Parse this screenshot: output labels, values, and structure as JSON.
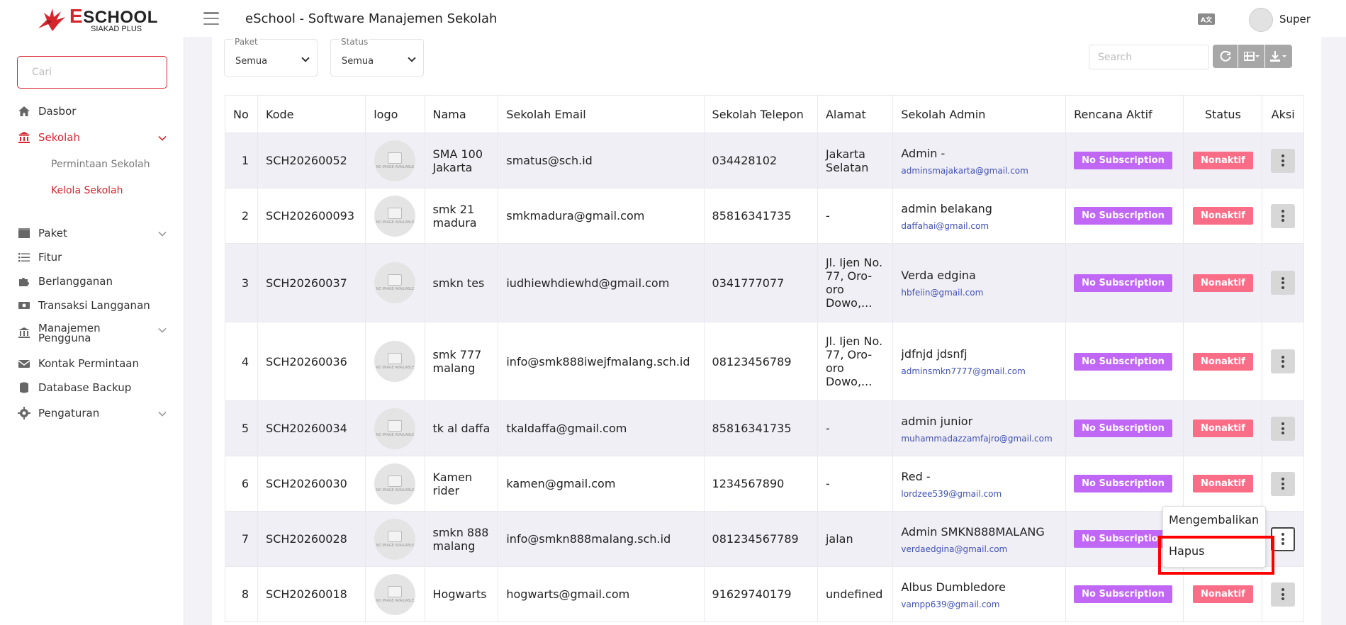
{
  "header": {
    "logo_title_first": "E",
    "logo_title_rest": "SCHOOL",
    "logo_subtitle": "SIAKAD PLUS",
    "app_title": "eSchool - Software Manajemen Sekolah",
    "lang_icon_label": "A文",
    "user_name": "Super"
  },
  "sidebar": {
    "search_placeholder": "Cari",
    "items": [
      {
        "label": "Dasbor",
        "icon": "home-icon"
      },
      {
        "label": "Sekolah",
        "icon": "school-icon"
      },
      {
        "label": "Permintaan Sekolah"
      },
      {
        "label": "Kelola Sekolah"
      },
      {
        "label": "Paket",
        "icon": "package-icon"
      },
      {
        "label": "Fitur",
        "icon": "list-icon"
      },
      {
        "label": "Berlangganan",
        "icon": "puzzle-icon"
      },
      {
        "label": "Transaksi Langganan",
        "icon": "money-icon"
      },
      {
        "label": "Manajemen Pengguna",
        "icon": "user-group-icon"
      },
      {
        "label": "Kontak Permintaan",
        "icon": "envelope-icon"
      },
      {
        "label": "Database Backup",
        "icon": "database-icon"
      },
      {
        "label": "Pengaturan",
        "icon": "gear-icon"
      }
    ]
  },
  "filters": {
    "paket_label": "Paket",
    "paket_value": "Semua",
    "status_label": "Status",
    "status_value": "Semua"
  },
  "toolbar": {
    "search_placeholder": "Search"
  },
  "table": {
    "columns": [
      "No",
      "Kode",
      "logo",
      "Nama",
      "Sekolah Email",
      "Sekolah Telepon",
      "Alamat",
      "Sekolah Admin",
      "Rencana Aktif",
      "Status",
      "Aksi"
    ],
    "logo_placeholder": "NO IMAGE AVAILABLE",
    "rows": [
      {
        "no": "1",
        "kode": "SCH20260052",
        "nama": "SMA 100 Jakarta",
        "email": "smatus@sch.id",
        "telepon": "034428102",
        "alamat": "Jakarta Selatan",
        "admin_name": "Admin -",
        "admin_email": "adminsmajakarta@gmail.com",
        "rencana": "No Subscription",
        "status": "Nonaktif"
      },
      {
        "no": "2",
        "kode": "SCH202600093",
        "nama": "smk 21 madura",
        "email": "smkmadura@gmail.com",
        "telepon": "85816341735",
        "alamat": "-",
        "admin_name": "admin belakang",
        "admin_email": "daffahai@gmail.com",
        "rencana": "No Subscription",
        "status": "Nonaktif"
      },
      {
        "no": "3",
        "kode": "SCH20260037",
        "nama": "smkn tes",
        "email": "iudhiewhdiewhd@gmail.com",
        "telepon": "0341777077",
        "alamat": "Jl. Ijen No. 77, Oro-oro Dowo,...",
        "admin_name": "Verda edgina",
        "admin_email": "hbfeiin@gmail.com",
        "rencana": "No Subscription",
        "status": "Nonaktif"
      },
      {
        "no": "4",
        "kode": "SCH20260036",
        "nama": "smk 777 malang",
        "email": "info@smk888iwejfmalang.sch.id",
        "telepon": "08123456789",
        "alamat": "Jl. Ijen No. 77, Oro-oro Dowo,...",
        "admin_name": "jdfnjd jdsnfj",
        "admin_email": "adminsmkn7777@gmail.com",
        "rencana": "No Subscription",
        "status": "Nonaktif"
      },
      {
        "no": "5",
        "kode": "SCH20260034",
        "nama": "tk al daffa",
        "email": "tkaldaffa@gmail.com",
        "telepon": "85816341735",
        "alamat": "-",
        "admin_name": "admin junior",
        "admin_email": "muhammadazzamfajro@gmail.com",
        "rencana": "No Subscription",
        "status": "Nonaktif"
      },
      {
        "no": "6",
        "kode": "SCH20260030",
        "nama": "Kamen rider",
        "email": "kamen@gmail.com",
        "telepon": "1234567890",
        "alamat": "-",
        "admin_name": "Red -",
        "admin_email": "lordzee539@gmail.com",
        "rencana": "No Subscription",
        "status": "Nonaktif"
      },
      {
        "no": "7",
        "kode": "SCH20260028",
        "nama": "smkn 888 malang",
        "email": "info@smkn888malang.sch.id",
        "telepon": "081234567789",
        "alamat": "jalan",
        "admin_name": "Admin SMKN888MALANG",
        "admin_email": "verdaedgina@gmail.com",
        "rencana": "No Subscription",
        "status": ""
      },
      {
        "no": "8",
        "kode": "SCH20260018",
        "nama": "Hogwarts",
        "email": "hogwarts@gmail.com",
        "telepon": "91629740179",
        "alamat": "undefined",
        "admin_name": "Albus Dumbledore",
        "admin_email": "vampp639@gmail.com",
        "rencana": "No Subscription",
        "status": "Nonaktif"
      }
    ]
  },
  "dropdown": {
    "restore_label": "Mengembalikan",
    "delete_label": "Hapus"
  },
  "colors": {
    "brand": "#d5262e",
    "subscription_badge": "#c067f5",
    "status_badge": "#fa6d86",
    "highlight": "#ff0000"
  }
}
